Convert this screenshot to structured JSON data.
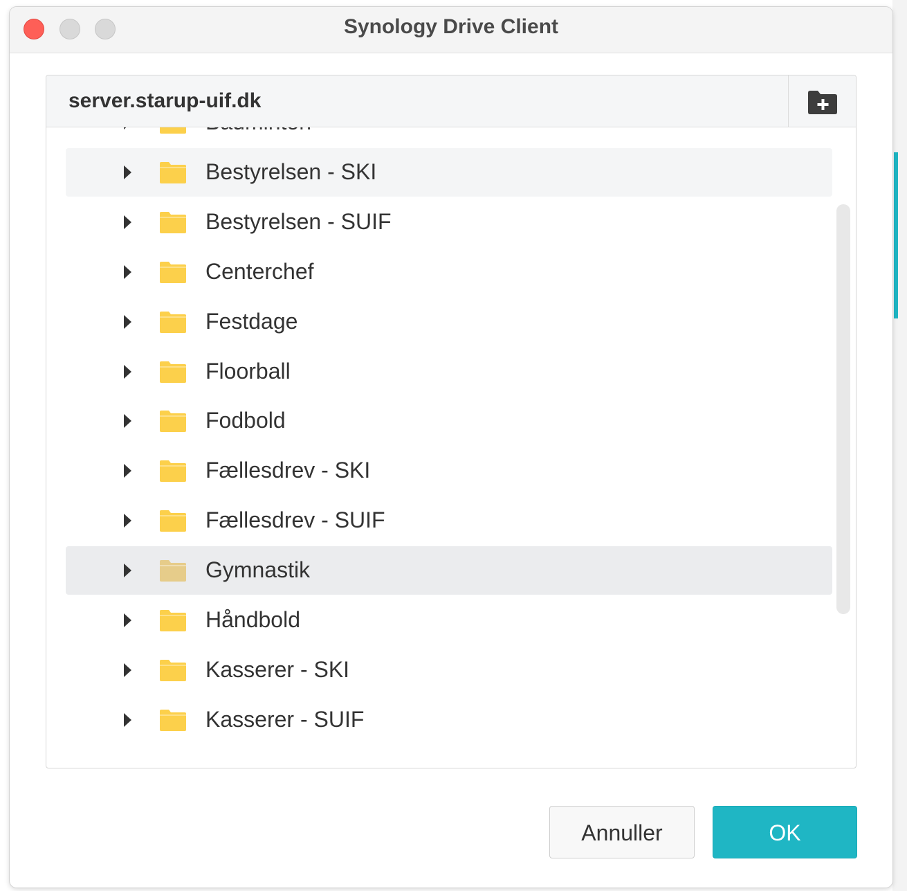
{
  "window": {
    "title": "Synology Drive Client"
  },
  "panel": {
    "server_name": "server.starup-uif.dk",
    "new_folder_icon": "new-folder-icon"
  },
  "folders": [
    {
      "label": "Badminton",
      "state": "normal"
    },
    {
      "label": "Bestyrelsen - SKI",
      "state": "hover"
    },
    {
      "label": "Bestyrelsen - SUIF",
      "state": "normal"
    },
    {
      "label": "Centerchef",
      "state": "normal"
    },
    {
      "label": "Festdage",
      "state": "normal"
    },
    {
      "label": "Floorball",
      "state": "normal"
    },
    {
      "label": "Fodbold",
      "state": "normal"
    },
    {
      "label": "Fællesdrev - SKI",
      "state": "normal"
    },
    {
      "label": "Fællesdrev - SUIF",
      "state": "normal"
    },
    {
      "label": "Gymnastik",
      "state": "selected"
    },
    {
      "label": "Håndbold",
      "state": "normal"
    },
    {
      "label": "Kasserer - SKI",
      "state": "normal"
    },
    {
      "label": "Kasserer - SUIF",
      "state": "normal"
    }
  ],
  "buttons": {
    "cancel_label": "Annuller",
    "ok_label": "OK"
  },
  "colors": {
    "accent": "#1fb6c4",
    "folder": "#fcd04b",
    "folder_dim": "#e6cc8a",
    "close": "#fe5f57"
  }
}
